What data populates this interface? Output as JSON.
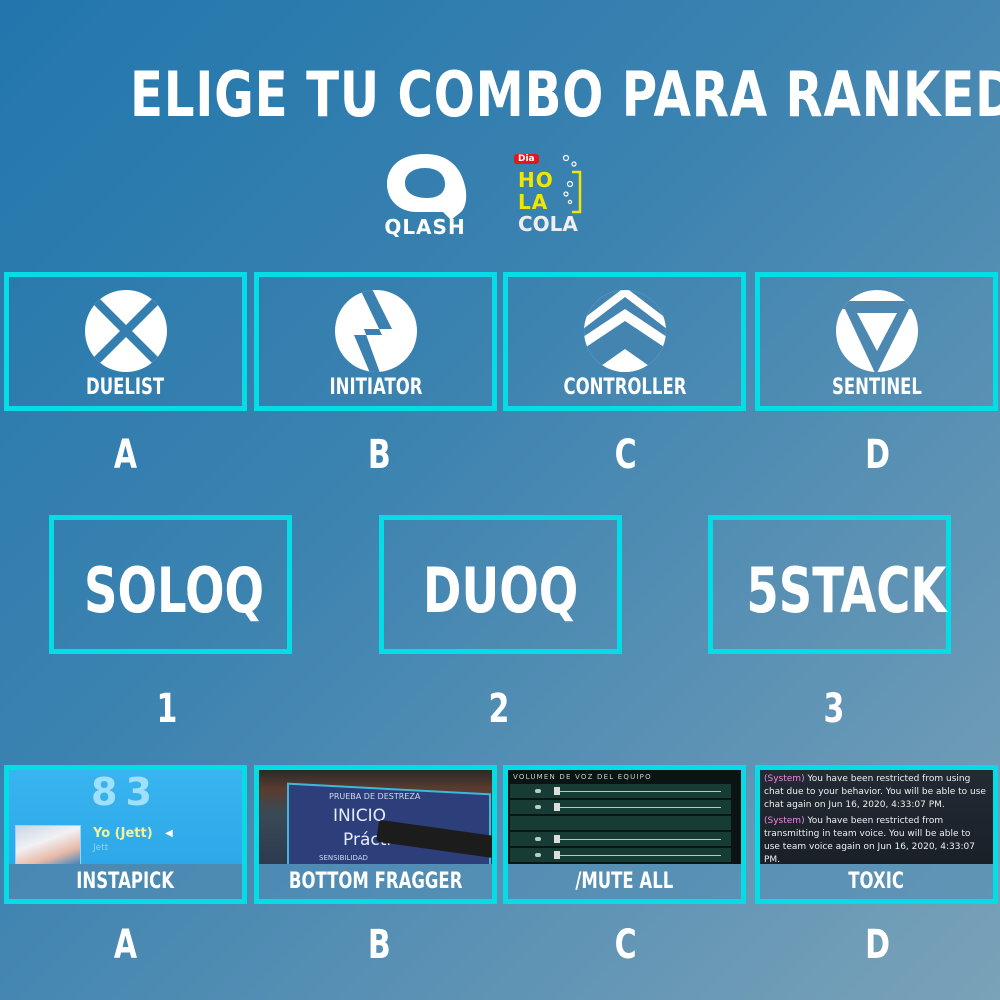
{
  "title": "ELIGE TU COMBO PARA RANKEDS",
  "logos": {
    "qlash": "QLASH",
    "hola_cola": {
      "badge": "Dia",
      "line1": "HO",
      "line2": "LA",
      "line3": "COLA"
    }
  },
  "colors": {
    "accent_border": "#04dce6",
    "text": "#ffffff",
    "bg_start": "#2276ad",
    "bg_end": "#7aa2b8"
  },
  "roles": [
    {
      "label": "DUELIST",
      "icon": "duelist-icon",
      "letter": "A"
    },
    {
      "label": "INITIATOR",
      "icon": "initiator-icon",
      "letter": "B"
    },
    {
      "label": "CONTROLLER",
      "icon": "controller-icon",
      "letter": "C"
    },
    {
      "label": "SENTINEL",
      "icon": "sentinel-icon",
      "letter": "D"
    }
  ],
  "modes": [
    {
      "label": "SOLOQ",
      "number": "1"
    },
    {
      "label": "DUOQ",
      "number": "2"
    },
    {
      "label": "5STACK",
      "number": "3"
    }
  ],
  "cards": [
    {
      "label": "INSTAPICK",
      "letter": "A",
      "score": "83",
      "player": "Yo (Jett)",
      "agent": "Jett"
    },
    {
      "label": "BOTTOM FRAGGER",
      "letter": "B",
      "panel_title": "PRUEBA DE DESTREZA",
      "option1": "INICIO",
      "option2": "Prácti",
      "option3": "SENSIBILIDAD"
    },
    {
      "label": "/MUTE ALL",
      "letter": "C",
      "panel_title": "VOLUMEN DE VOZ DEL EQUIPO"
    },
    {
      "label": "TOXIC",
      "letter": "D",
      "messages": [
        {
          "tag": "(System)",
          "text": "You have been restricted from using chat due to your behavior. You will be able to use chat again on Jun 16, 2020, 4:33:07 PM."
        },
        {
          "tag": "(System)",
          "text": "You have been restricted from transmitting in team voice. You will be able to use team voice again on Jun 16, 2020, 4:33:07 PM."
        }
      ]
    }
  ]
}
